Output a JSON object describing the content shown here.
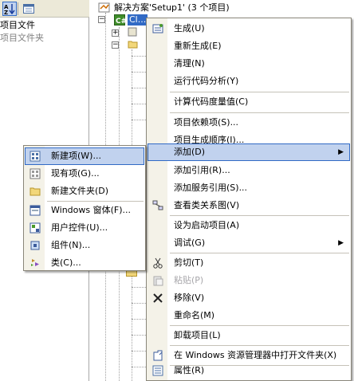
{
  "left_panel": {
    "rows": [
      "项目文件",
      "项目文件夹"
    ]
  },
  "tree": {
    "solution_label": "解决方案'Setup1' (3 个项目)",
    "project_label": "Cl..."
  },
  "context_menu": {
    "items": [
      {
        "label": "生成(U)",
        "icon": "build-icon"
      },
      {
        "label": "重新生成(E)",
        "icon": ""
      },
      {
        "label": "清理(N)",
        "icon": ""
      },
      {
        "label": "运行代码分析(Y)",
        "icon": ""
      },
      {
        "label": "计算代码度量值(C)",
        "icon": ""
      },
      {
        "label": "项目依赖项(S)...",
        "icon": ""
      },
      {
        "label": "项目生成顺序(I)...",
        "icon": ""
      },
      {
        "label": "添加(D)",
        "icon": "",
        "submenu": true
      },
      {
        "label": "添加引用(R)...",
        "icon": ""
      },
      {
        "label": "添加服务引用(S)...",
        "icon": ""
      },
      {
        "label": "查看类关系图(V)",
        "icon": "class-diagram-icon"
      },
      {
        "label": "设为启动项目(A)",
        "icon": ""
      },
      {
        "label": "调试(G)",
        "icon": "",
        "submenu": true
      },
      {
        "label": "剪切(T)",
        "icon": "scissors-icon"
      },
      {
        "label": "粘贴(P)",
        "icon": "paste-icon",
        "disabled": true
      },
      {
        "label": "移除(V)",
        "icon": "delete-x-icon"
      },
      {
        "label": "重命名(M)",
        "icon": ""
      },
      {
        "label": "卸载项目(L)",
        "icon": ""
      },
      {
        "label": "在 Windows 资源管理器中打开文件夹(X)",
        "icon": "open-folder-icon"
      },
      {
        "label": "属性(R)",
        "icon": "properties-icon"
      }
    ]
  },
  "add_submenu": {
    "items": [
      {
        "label": "新建项(W)...",
        "icon": "new-item-icon"
      },
      {
        "label": "现有项(G)...",
        "icon": "existing-item-icon"
      },
      {
        "label": "新建文件夹(D)",
        "icon": "new-folder-icon"
      },
      {
        "label": "Windows 窗体(F)...",
        "icon": "windows-form-icon"
      },
      {
        "label": "用户控件(U)...",
        "icon": "user-control-icon"
      },
      {
        "label": "组件(N)...",
        "icon": "component-icon"
      },
      {
        "label": "类(C)...",
        "icon": "class-icon"
      }
    ]
  }
}
